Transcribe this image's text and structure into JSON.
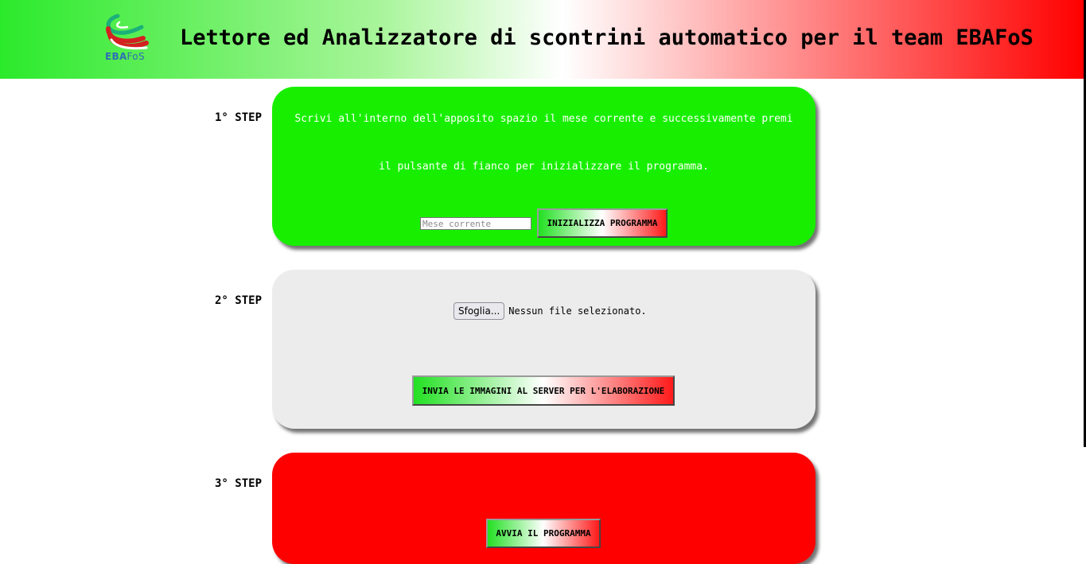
{
  "header": {
    "logo_text_bold": "EBA",
    "logo_text_light": "FoS",
    "title": "Lettore ed Analizzatore di scontrini automatico per il team EBAFoS"
  },
  "step1": {
    "label": "1° STEP",
    "instruction_line1": "Scrivi all'interno dell'apposito spazio il mese corrente e successivamente premi",
    "instruction_line2": "il pulsante di fianco per inizializzare il programma.",
    "month_input": {
      "value": "",
      "placeholder": "Mese corrente"
    },
    "init_button": "INIZIALIZZA PROGRAMMA"
  },
  "step2": {
    "label": "2° STEP",
    "browse_button": "Sfoglia...",
    "file_status": "Nessun file selezionato.",
    "send_button": "INVIA LE IMMAGINI AL SERVER PER L'ELABORAZIONE"
  },
  "step3": {
    "label": "3° STEP",
    "run_button": "AVVIA IL PROGRAMMA"
  },
  "colors": {
    "step1_panel": "#18ef00",
    "step2_panel": "#ececec",
    "step3_panel": "#ff0000",
    "logo_text": "#2f6fb4"
  },
  "icons": {
    "logo": "ebafos-tricolor-swoosh-logo"
  }
}
